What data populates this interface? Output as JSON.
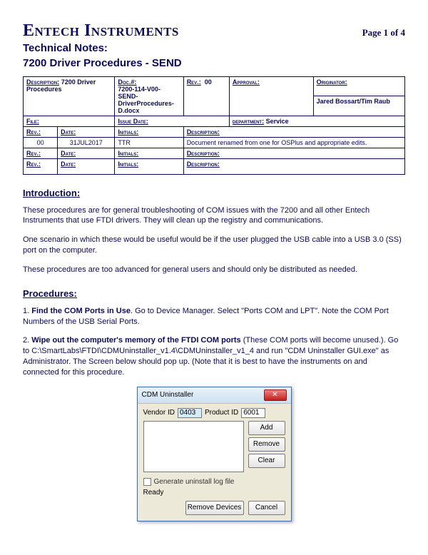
{
  "header": {
    "company": "Entech Instruments",
    "page": "Page 1 of 4",
    "line1": "Technical Notes:",
    "line2": "7200 Driver Procedures - SEND"
  },
  "meta": {
    "labels": {
      "description": "Description:",
      "doc": "Doc.#:",
      "rev": "Rev.:",
      "approval": "Approval:",
      "originator": "Originator:",
      "file": "File:",
      "issue_date": "Issue Date:",
      "department": "department:",
      "rev_col": "Rev.:",
      "date_col": "Date:",
      "initials": "Initials:",
      "desc_col": "Description:"
    },
    "description_val": "7200 Driver Procedures",
    "doc_val": "7200-114-V00-SEND-DriverProcedures-D.docx",
    "rev_val": "00",
    "originator_val": "Jared Bossart/Tim Raub",
    "department_val": "Service",
    "revs": [
      {
        "rev": "00",
        "date": "31JUL2017",
        "initials": "TTR",
        "desc": "Document renamed from one for OSPlus and appropriate edits."
      },
      {
        "rev": "",
        "date": "",
        "initials": "",
        "desc": ""
      },
      {
        "rev": "",
        "date": "",
        "initials": "",
        "desc": ""
      }
    ]
  },
  "sections": {
    "intro": "Introduction:",
    "proc": "Procedures:"
  },
  "intro": {
    "p1": "These procedures are for general troubleshooting of COM issues with the 7200 and all other Entech Instruments that use FTDI drivers.  They will clean up the registry and communications.",
    "p2": "One scenario in which these would be useful would be if the user plugged the USB cable into a USB 3.0 (SS) port on the computer.",
    "p3": "These procedures are too advanced for general users and should only be distributed as needed."
  },
  "proc": {
    "step1_num": "1.  ",
    "step1_bold": "Find the COM Ports in Use",
    "step1_rest": ".  Go to Device Manager.  Select \"Ports COM and LPT\".  Note the COM Port Numbers of the USB Serial Ports.",
    "step2_num": "2.  ",
    "step2_bold": "Wipe out the computer's memory of the FTDI COM ports",
    "step2_rest": " (These COM ports will become unused.).  Go to C:\\SmartLabs\\FTDI\\CDMUninstaller_v1.4\\CDMUninstaller_v1_4 and run \"CDM Uninstaller GUI.exe\" as Administrator.  The Screen below should pop up.  (Note that it is best to have the instruments on and connected for this procedure."
  },
  "dlg": {
    "title": "CDM Uninstaller",
    "vendor_lbl": "Vendor ID",
    "vendor_val": "0403",
    "product_lbl": "Product ID",
    "product_val": "6001",
    "btn_add": "Add",
    "btn_remove": "Remove",
    "btn_clear": "Clear",
    "chk": "Generate uninstall log file",
    "status": "Ready",
    "btn_remove_devices": "Remove Devices",
    "btn_cancel": "Cancel"
  }
}
